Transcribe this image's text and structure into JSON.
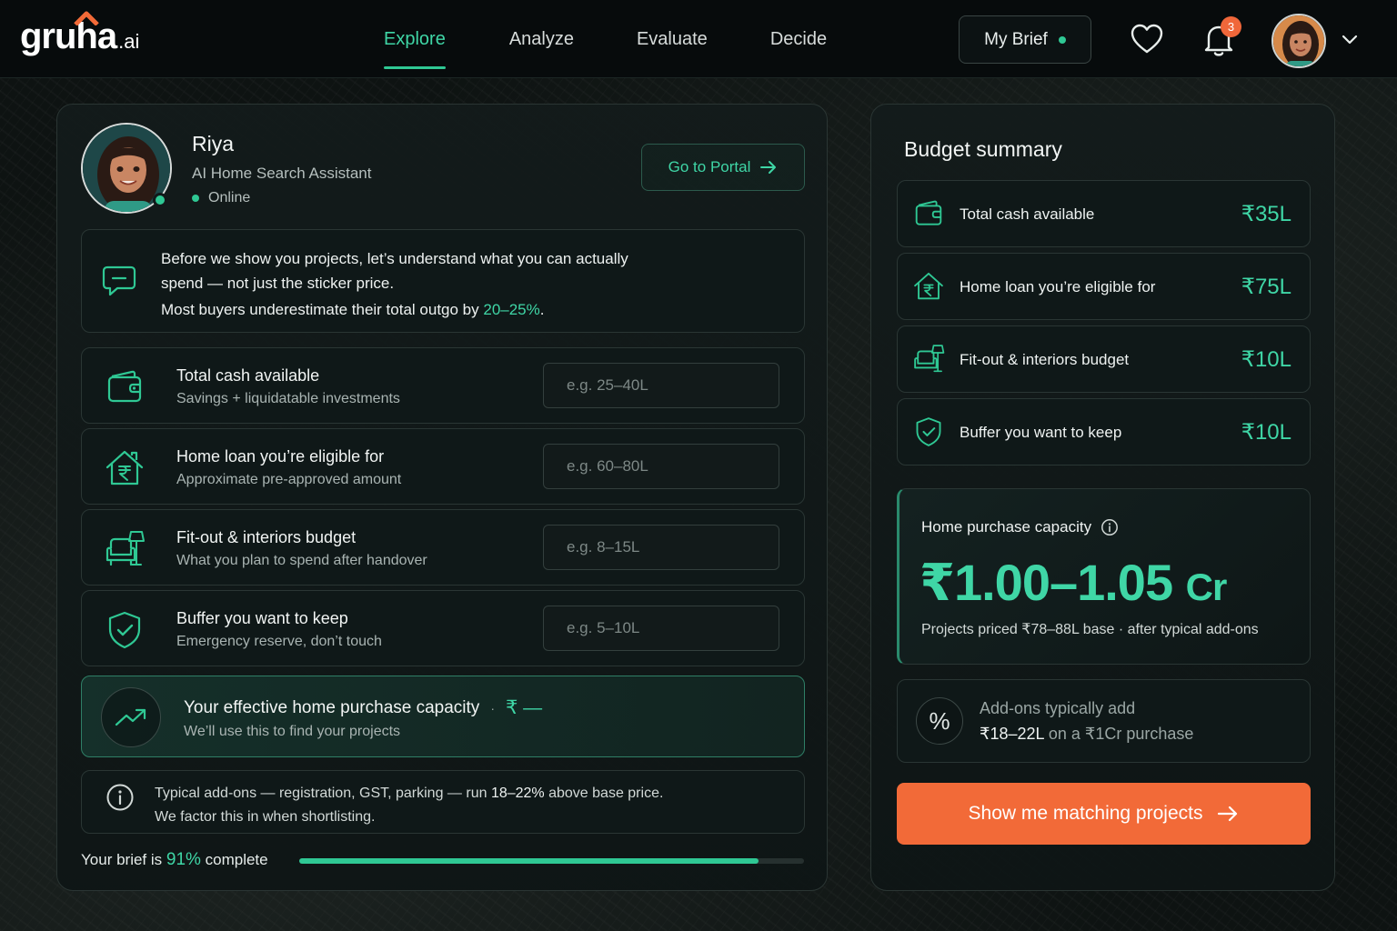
{
  "brand": {
    "name": "gruha",
    "suffix": ".ai",
    "accent": "#2fc894",
    "cta_color": "#f26a38"
  },
  "nav": {
    "tabs": [
      {
        "label": "Explore",
        "active": true
      },
      {
        "label": "Analyze",
        "active": false
      },
      {
        "label": "Evaluate",
        "active": false
      },
      {
        "label": "Decide",
        "active": false
      }
    ],
    "brief_label": "My Brief",
    "notifications_count": "3",
    "icons": [
      "heart-icon",
      "bell-icon",
      "chevron-down-icon"
    ]
  },
  "assistant": {
    "name": "Riya",
    "role": "AI Home Search Assistant",
    "status": "Online",
    "portal_label": "Go to Portal"
  },
  "intro": {
    "line1": "Before we show you projects, let’s understand what you can actually",
    "line2": "spend — not just the sticker price.",
    "line3_pre": "Most buyers underestimate their total outgo by ",
    "line3_pct": "20–25%",
    "line3_post": "."
  },
  "fields": [
    {
      "icon": "wallet-icon",
      "label": "Total cash available",
      "sub": "Savings + liquidatable investments",
      "placeholder": "e.g. 25–40L",
      "value": ""
    },
    {
      "icon": "house-rupee-icon",
      "label": "Home loan you’re eligible for",
      "sub": "Approximate pre-approved amount",
      "placeholder": "e.g. 60–80L",
      "value": ""
    },
    {
      "icon": "armchair-lamp-icon",
      "label": "Fit-out & interiors budget",
      "sub": "What you plan to spend after handover",
      "placeholder": "e.g. 8–15L",
      "value": ""
    },
    {
      "icon": "shield-check-icon",
      "label": "Buffer you want to keep",
      "sub": "Emergency reserve, don’t touch",
      "placeholder": "e.g. 5–10L",
      "value": ""
    }
  ],
  "capacity": {
    "title": "Your effective home purchase capacity",
    "separator": "·",
    "value": "₹ —",
    "sub": "We’ll use this to find your projects"
  },
  "note": {
    "line1_pre": "Typical add-ons — registration, GST, parking — run ",
    "line1_pct": "18–22%",
    "line1_post": " above base price.",
    "line2": "We factor this in when shortlisting."
  },
  "progress": {
    "pre": "Your brief is ",
    "pct_label": "91%",
    "post": " complete",
    "value": 0.91
  },
  "summary": {
    "title": "Budget summary",
    "rows": [
      {
        "icon": "wallet-icon",
        "label": "Total cash available",
        "value": "₹35L"
      },
      {
        "icon": "house-rupee-icon",
        "label": "Home loan you’re eligible for",
        "value": "₹75L"
      },
      {
        "icon": "armchair-lamp-icon",
        "label": "Fit-out & interiors budget",
        "value": "₹10L"
      },
      {
        "icon": "shield-check-icon",
        "label": "Buffer you want to keep",
        "value": "₹10L"
      }
    ],
    "hpc": {
      "title": "Home purchase capacity",
      "value": "₹1.00–1.05",
      "unit": "Cr",
      "sub": "Projects priced ₹78–88L base · after typical add-ons"
    },
    "addons": {
      "line1": "Add-ons typically add",
      "amount": "₹18–22L",
      "line2_post": " on a ₹1Cr purchase"
    },
    "cta_label": "Show me matching projects"
  }
}
